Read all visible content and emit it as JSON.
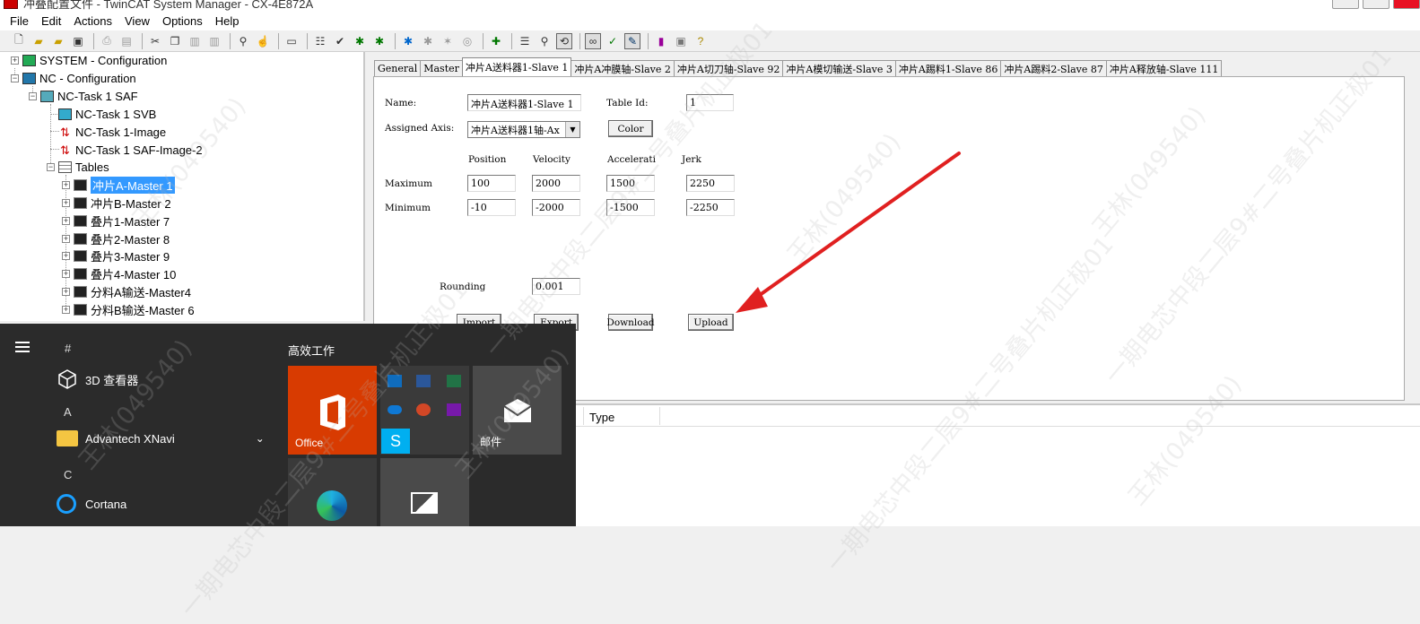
{
  "window": {
    "title": "冲叠配置文件 - TwinCAT System Manager - CX-4E872A"
  },
  "menu": {
    "items": [
      "File",
      "Edit",
      "Actions",
      "View",
      "Options",
      "Help"
    ]
  },
  "tree": {
    "system": "SYSTEM - Configuration",
    "nc": "NC - Configuration",
    "task": "NC-Task 1 SAF",
    "svb": "NC-Task 1 SVB",
    "image": "NC-Task 1-Image",
    "saf_image": "NC-Task 1 SAF-Image-2",
    "tables": "Tables",
    "tables_items": [
      "冲片A-Master 1",
      "冲片B-Master 2",
      "叠片1-Master 7",
      "叠片2-Master 8",
      "叠片3-Master 9",
      "叠片4-Master 10",
      "分料A输送-Master4",
      "分料B输送-Master 6"
    ]
  },
  "tabs": [
    "General",
    "Master",
    "冲片A送料器1-Slave 1",
    "冲片A冲膜轴-Slave 2",
    "冲片A切刀轴-Slave 92",
    "冲片A模切输送-Slave 3",
    "冲片A踢料1-Slave 86",
    "冲片A踢料2-Slave 87",
    "冲片A释放轴-Slave 111"
  ],
  "active_tab": 2,
  "form": {
    "name_label": "Name:",
    "name_value": "冲片A送料器1-Slave 1",
    "table_id_label": "Table Id:",
    "table_id_value": "1",
    "assigned_axis_label": "Assigned Axis:",
    "assigned_axis_value": "冲片A送料器1轴-Ax",
    "color_button": "Color",
    "col_position": "Position",
    "col_velocity": "Velocity",
    "col_acceleration": "Accelerati",
    "col_jerk": "Jerk",
    "row_maximum": "Maximum",
    "row_minimum": "Minimum",
    "max_position": "100",
    "max_velocity": "2000",
    "max_acceleration": "1500",
    "max_jerk": "2250",
    "min_position": "-10",
    "min_velocity": "-2000",
    "min_acceleration": "-1500",
    "min_jerk": "-2250",
    "rounding_label": "Rounding",
    "rounding_value": "0.001",
    "import_button": "Import",
    "export_button": "Export",
    "download_button": "Download",
    "upload_button": "Upload"
  },
  "lower_pane": {
    "type_header": "Type"
  },
  "start_menu": {
    "symbol_header": "#",
    "app_3d": "3D 查看器",
    "letter_a": "A",
    "app_advantech": "Advantech XNavi",
    "letter_c": "C",
    "app_cortana": "Cortana",
    "group_title": "高效工作",
    "tile_office": "Office",
    "tile_mail": "邮件"
  },
  "watermark": {
    "lines": [
      "王林(049540)",
      "一期电芯中段二层9#二号叠片机正极01"
    ]
  },
  "colors": {
    "arrow": "#e02020",
    "selection": "#3399ff",
    "office_tile": "#d83b01"
  }
}
